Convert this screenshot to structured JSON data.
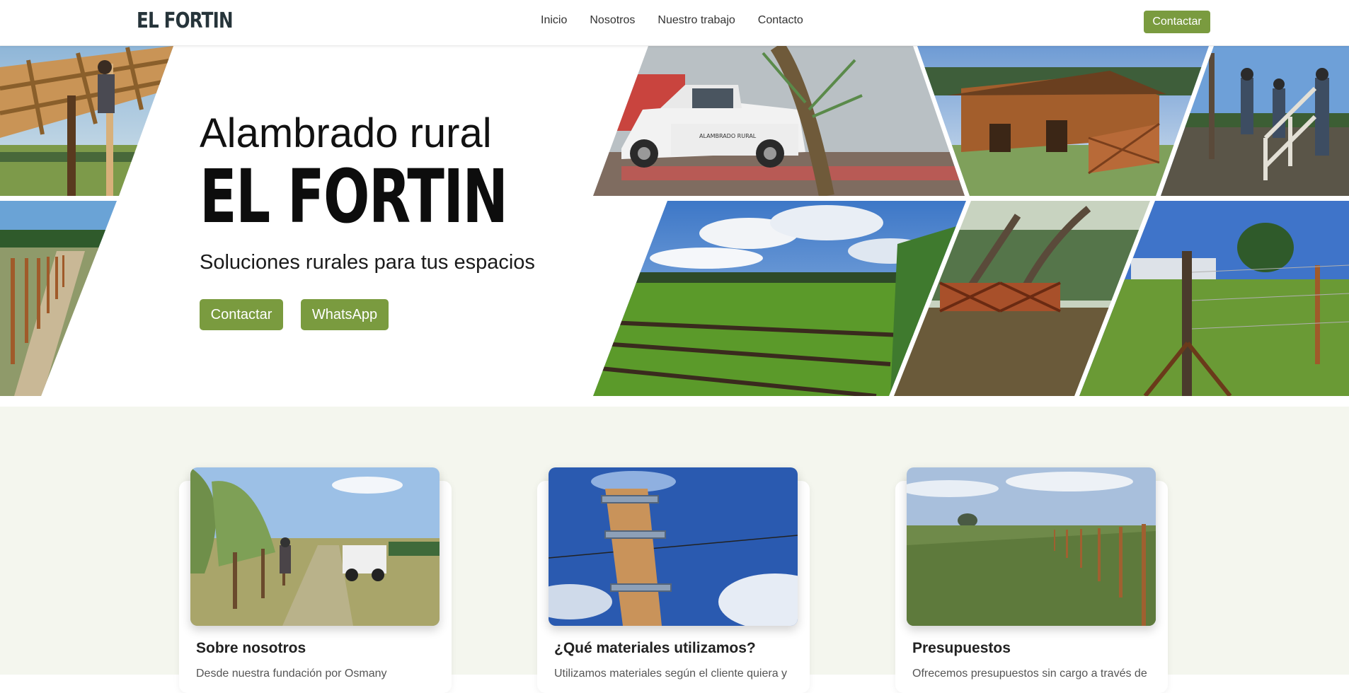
{
  "nav": {
    "brand": "EL FORTIN",
    "links": [
      "Inicio",
      "Nosotros",
      "Nuestro trabajo",
      "Contacto"
    ],
    "cta": "Contactar",
    "accent_color": "#7a9b3f"
  },
  "hero": {
    "title_line1": "Alambrado rural",
    "title_line2": "EL FORTIN",
    "subtitle": "Soluciones rurales para tus espacios",
    "buttons": {
      "contact": "Contactar",
      "whatsapp": "WhatsApp"
    },
    "truck_text": "ALAMBRADO RURAL"
  },
  "cards": [
    {
      "title": "Sobre nosotros",
      "text": "Desde nuestra fundación por Osmany"
    },
    {
      "title": "¿Qué materiales utilizamos?",
      "text": "Utilizamos materiales según el cliente quiera y"
    },
    {
      "title": "Presupuestos",
      "text": "Ofrecemos presupuestos sin cargo a través de"
    }
  ]
}
